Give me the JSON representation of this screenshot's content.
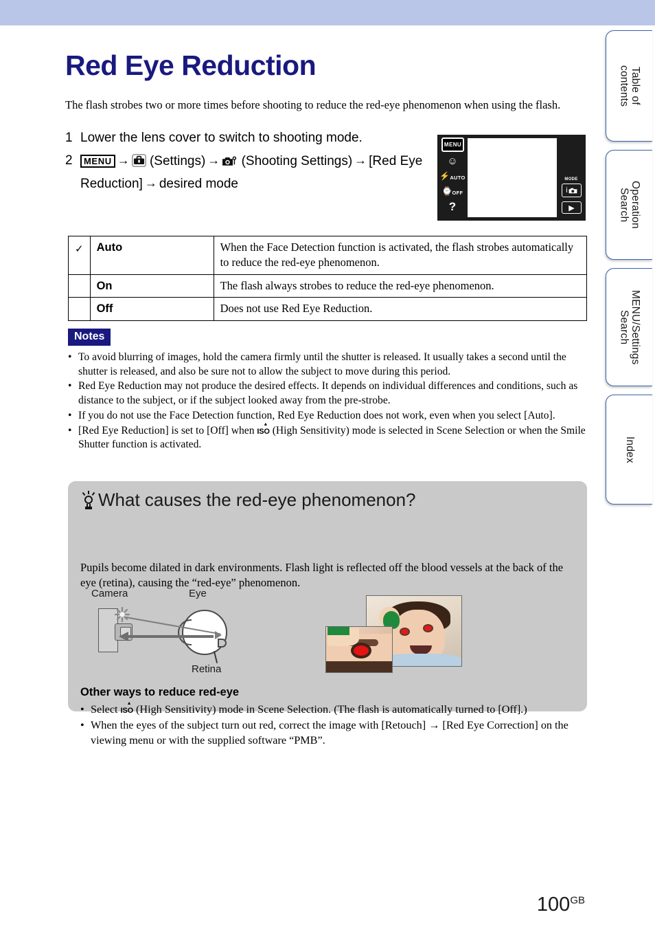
{
  "header": {
    "band_color": "#b9c6e7"
  },
  "title": "Red Eye Reduction",
  "intro": "The flash strobes two or more times before shooting to reduce the red-eye phenomenon when using the flash.",
  "steps": [
    {
      "num": "1",
      "text": "Lower the lens cover to switch to shooting mode."
    }
  ],
  "step2": {
    "num": "2",
    "menu_chip": "MENU",
    "arrow": "→",
    "settings_label": "(Settings)",
    "shooting_label": "(Shooting Settings)",
    "bracket_item": "[Red Eye Reduction]",
    "tail": "desired mode"
  },
  "lcd": {
    "menu_button": "MENU",
    "smile_icon": "☺",
    "flash_label": "AUTO",
    "timer_label": "OFF",
    "help_icon": "?",
    "mode_label": "MODE",
    "mode_value": "i",
    "play_icon": "▶"
  },
  "options_table": {
    "rows": [
      {
        "checked": "✓",
        "name": "Auto",
        "description": "When the Face Detection function is activated, the flash strobes automatically to reduce the red-eye phenomenon."
      },
      {
        "checked": "",
        "name": "On",
        "description": "The flash always strobes to reduce the red-eye phenomenon."
      },
      {
        "checked": "",
        "name": "Off",
        "description": "Does not use Red Eye Reduction."
      }
    ]
  },
  "notes": {
    "badge": "Notes",
    "items": [
      "To avoid blurring of images, hold the camera firmly until the shutter is released. It usually takes a second until the shutter is released, and also be sure not to allow the subject to move during this period.",
      "Red Eye Reduction may not produce the desired effects. It depends on individual differences and conditions, such as distance to the subject, or if the subject looked away from the pre-strobe.",
      "If you do not use the Face Detection function, Red Eye Reduction does not work, even when you select [Auto]."
    ],
    "item4_pre": "[Red Eye Reduction] is set to [Off] when",
    "item4_iso": "ISO",
    "item4_post": "(High Sensitivity) mode is selected in Scene Selection or when the Smile Shutter function is activated.",
    "bullet": "•"
  },
  "tip": {
    "heading": "What causes the red-eye phenomenon?",
    "paragraph": "Pupils become dilated in dark environments. Flash light is reflected off the blood vessels at the back of the eye (retina), causing the “red-eye” phenomenon.",
    "diagram": {
      "camera_label": "Camera",
      "eye_label": "Eye",
      "retina_label": "Retina"
    },
    "other_heading": "Other ways to reduce red-eye",
    "other_bullet1_pre": "Select",
    "other_bullet1_iso": "ISO",
    "other_bullet1_post": "(High Sensitivity) mode in Scene Selection. (The flash is automatically turned to [Off].)",
    "other_bullet2": "When the eyes of the subject turn out red, correct the image with [Retouch] → [Red Eye Correction] on the viewing menu or with the supplied software “PMB”.",
    "bullet": "•"
  },
  "tabs": [
    {
      "label": "Table of\ncontents"
    },
    {
      "label": "Operation\nSearch"
    },
    {
      "label": "MENU/Settings\nSearch"
    },
    {
      "label": "Index"
    }
  ],
  "page_number": {
    "value": "100",
    "suffix": "GB"
  }
}
